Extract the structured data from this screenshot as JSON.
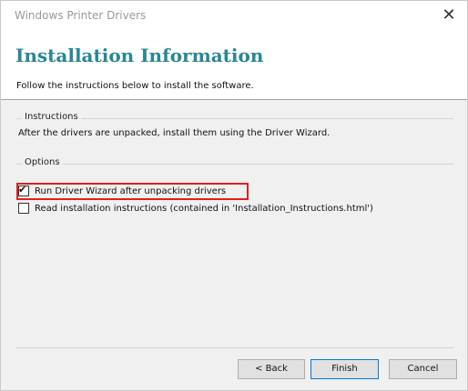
{
  "window": {
    "title": "Windows Printer Drivers",
    "close_glyph": "✕"
  },
  "header": {
    "title": "Installation Information",
    "subtitle": "Follow the instructions below to install the software."
  },
  "instructions": {
    "group_label": "Instructions",
    "text": "After the drivers are unpacked, install them using the Driver Wizard."
  },
  "options": {
    "group_label": "Options",
    "items": [
      {
        "label": "Run Driver Wizard after unpacking drivers",
        "checked": true,
        "mark": "✔"
      },
      {
        "label": "Read installation instructions (contained in 'Installation_Instructions.html')",
        "checked": false,
        "mark": ""
      }
    ]
  },
  "buttons": {
    "back": "< Back",
    "finish": "Finish",
    "cancel": "Cancel"
  },
  "colors": {
    "header_title": "#2a8696",
    "highlight": "#e02020",
    "body_bg": "#f0f0f0"
  }
}
